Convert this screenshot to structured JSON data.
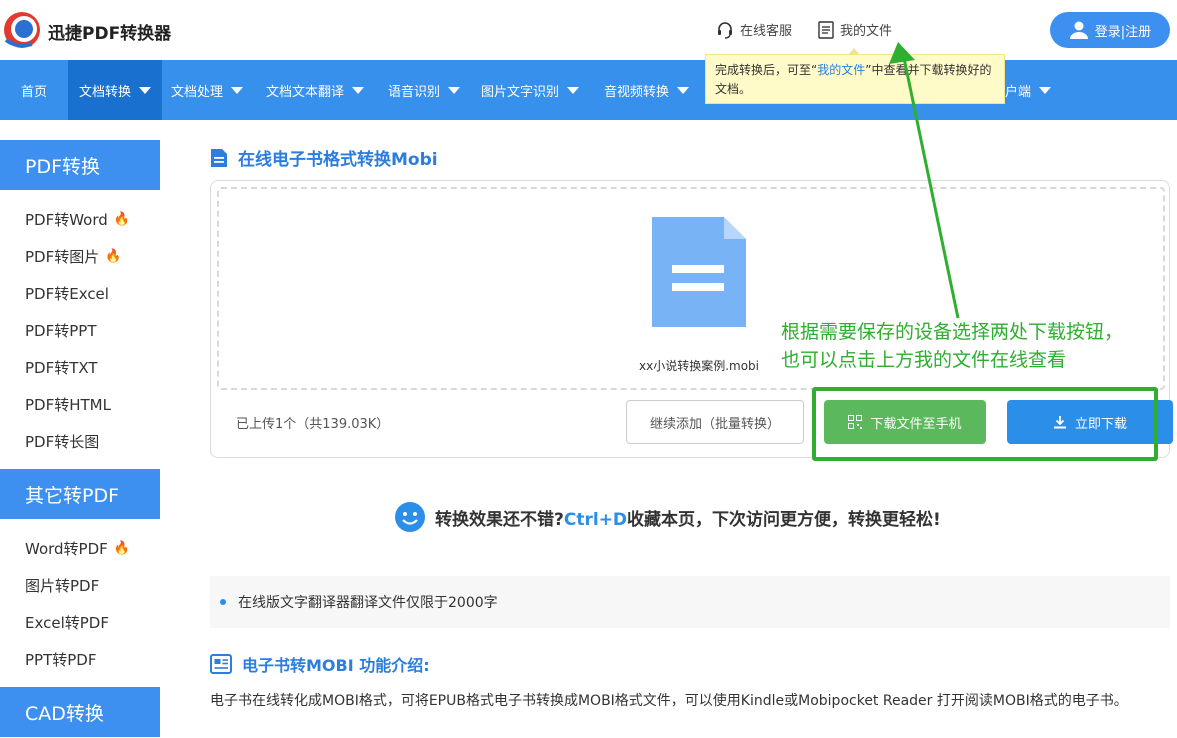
{
  "header": {
    "brand": "迅捷PDF转换器",
    "service": "在线客服",
    "my_files": "我的文件",
    "login": "登录|注册"
  },
  "nav": {
    "items": [
      {
        "label": "首页"
      },
      {
        "label": "文档转换"
      },
      {
        "label": "文档处理"
      },
      {
        "label": "文档文本翻译"
      },
      {
        "label": "语音识别"
      },
      {
        "label": "图片文字识别"
      },
      {
        "label": "音视频转换"
      },
      {
        "label": "户端"
      }
    ]
  },
  "tooltip": {
    "part1": "完成转换后，可至“",
    "highlight": "我的文件",
    "part2": "”中查看并下载转换好的文档。"
  },
  "sidebar": {
    "groups": [
      {
        "title": "PDF转换",
        "items": [
          {
            "label": "PDF转Word",
            "hot": true
          },
          {
            "label": "PDF转图片",
            "hot": true
          },
          {
            "label": "PDF转Excel",
            "hot": false
          },
          {
            "label": "PDF转PPT",
            "hot": false
          },
          {
            "label": "PDF转TXT",
            "hot": false
          },
          {
            "label": "PDF转HTML",
            "hot": false
          },
          {
            "label": "PDF转长图",
            "hot": false
          }
        ]
      },
      {
        "title": "其它转PDF",
        "items": [
          {
            "label": "Word转PDF",
            "hot": true
          },
          {
            "label": "图片转PDF",
            "hot": false
          },
          {
            "label": "Excel转PDF",
            "hot": false
          },
          {
            "label": "PPT转PDF",
            "hot": false
          }
        ]
      },
      {
        "title": "CAD转换",
        "items": []
      }
    ]
  },
  "main": {
    "title": "在线电子书格式转换Mobi",
    "file_name": "xx小说转换案例.mobi",
    "upload_info": "已上传1个（共139.03K）",
    "add_more": "继续添加（批量转换）",
    "download_phone": "下载文件至手机",
    "download_now": "立即下载",
    "annotation": "根据需要保存的设备选择两处下载按钮，也可以点击上方我的文件在线查看",
    "promo_part1": "转换效果还不错?",
    "promo_highlight": "Ctrl+D",
    "promo_part2": "收藏本页，下次访问更方便，转换更轻松!",
    "note": "在线版文字翻译器翻译文件仅限于2000字",
    "intro_title": "电子书转MOBI 功能介绍:",
    "intro_text": "电子书在线转化成MOBI格式，可将EPUB格式电子书转换成MOBI格式文件，可以使用Kindle或Mobipocket Reader 打开阅读MOBI格式的电子书。"
  },
  "colors": {
    "primary": "#3790ec",
    "active": "#1a70cf",
    "annotation": "#2fae2f",
    "download_green": "#5cb85c"
  }
}
